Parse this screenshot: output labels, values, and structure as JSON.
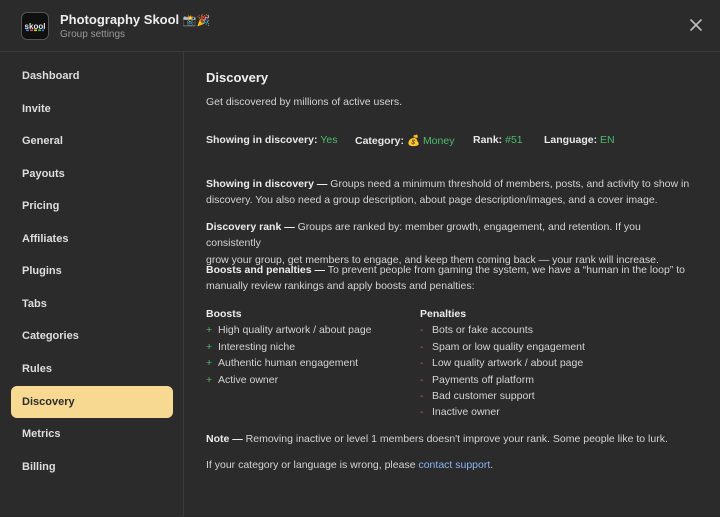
{
  "header": {
    "title": "Photography Skool",
    "title_emojis": "📸🎉",
    "subtitle": "Group settings",
    "logo_text": "skool"
  },
  "sidebar": {
    "items": [
      {
        "label": "Dashboard"
      },
      {
        "label": "Invite"
      },
      {
        "label": "General"
      },
      {
        "label": "Payouts"
      },
      {
        "label": "Pricing"
      },
      {
        "label": "Affiliates"
      },
      {
        "label": "Plugins"
      },
      {
        "label": "Tabs"
      },
      {
        "label": "Categories"
      },
      {
        "label": "Rules"
      },
      {
        "label": "Discovery",
        "active": true
      },
      {
        "label": "Metrics"
      },
      {
        "label": "Billing"
      }
    ]
  },
  "main": {
    "title": "Discovery",
    "subtitle": "Get discovered by millions of active users.",
    "stats": {
      "showing_label": "Showing in discovery:",
      "showing_value": "Yes",
      "category_label": "Category:",
      "category_emoji": "💰",
      "category_value": "Money",
      "rank_label": "Rank:",
      "rank_value": "#51",
      "language_label": "Language:",
      "language_value": "EN"
    },
    "sections": {
      "showing": {
        "label": "Showing in discovery —",
        "line1": " Groups need a minimum threshold of members, posts, and activity to show in",
        "line2": "discovery. You also need a group description, about page description/images, and a cover image."
      },
      "rank": {
        "label": "Discovery rank —",
        "line1": " Groups are ranked by: member growth, engagement, and retention. If you consistently",
        "line2": "grow your group, get members to engage, and keep them coming back — your rank will increase."
      },
      "boosts": {
        "label": "Boosts and penalties —",
        "line1": " To prevent people from gaming the system, we have a “human in the loop” to",
        "line2": "manually review rankings and apply boosts and penalties:"
      }
    },
    "boosts_heading": "Boosts",
    "boosts": [
      "High quality artwork / about page",
      "Interesting niche",
      "Authentic human engagement",
      "Active owner"
    ],
    "penalties_heading": "Penalties",
    "penalties": [
      "Bots or fake accounts",
      "Spam or low quality engagement",
      "Low quality artwork / about page",
      "Payments off platform",
      "Bad customer support",
      "Inactive owner"
    ],
    "note_label": "Note —",
    "note_text": " Removing inactive or level 1 members doesn't improve your rank. Some people like to lurk.",
    "footer_text": "If your category or language is wrong, please ",
    "footer_link": "contact support",
    "footer_end": ".",
    "colors": {
      "accent_green": "#4dbb6a",
      "penalty_red": "#e0524f",
      "active_nav": "#f7d991",
      "link": "#8cb4f5"
    }
  }
}
